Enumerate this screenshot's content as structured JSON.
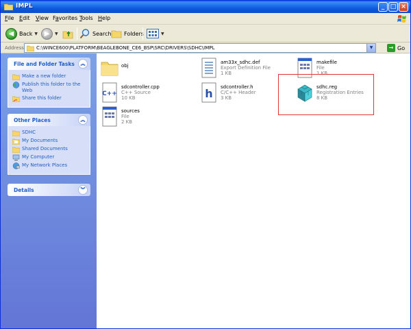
{
  "window": {
    "title": "IMPL"
  },
  "menu": [
    "File",
    "Edit",
    "View",
    "Favorites",
    "Tools",
    "Help"
  ],
  "menu_mnemonics": [
    "F",
    "E",
    "V",
    "a",
    "T",
    "H"
  ],
  "toolbar": {
    "back": "Back",
    "search": "Search",
    "folders": "Folders"
  },
  "address": {
    "label": "Address",
    "path": "C:\\WINCE600\\PLATFORM\\BEAGLEBONE_CE6_BSP\\SRC\\DRIVERS\\SDHC\\IMPL",
    "go": "Go"
  },
  "left": {
    "tasks": {
      "title": "File and Folder Tasks",
      "items": [
        "Make a new folder",
        "Publish this folder to the Web",
        "Share this folder"
      ]
    },
    "places": {
      "title": "Other Places",
      "items": [
        "SDHC",
        "My Documents",
        "Shared Documents",
        "My Computer",
        "My Network Places"
      ]
    },
    "details": {
      "title": "Details"
    }
  },
  "files": [
    {
      "name": "obj",
      "type": "",
      "size": "",
      "icon": "folder-icon"
    },
    {
      "name": "am33x_sdhc.def",
      "type": "Export Definition File",
      "size": "1 KB",
      "icon": "def-file-icon"
    },
    {
      "name": "makefile",
      "type": "File",
      "size": "1 KB",
      "icon": "generic-file-icon"
    },
    {
      "name": "sdcontroller.cpp",
      "type": "C++ Source",
      "size": "10 KB",
      "icon": "cpp-file-icon"
    },
    {
      "name": "sdcontroller.h",
      "type": "C/C++ Header",
      "size": "3 KB",
      "icon": "header-file-icon"
    },
    {
      "name": "sdhc.reg",
      "type": "Registration Entries",
      "size": "8 KB",
      "icon": "registry-file-icon"
    },
    {
      "name": "sources",
      "type": "File",
      "size": "2 KB",
      "icon": "generic-file-icon"
    }
  ],
  "colors": {
    "title_bar": "#0a5ee8",
    "task_link": "#215dc6",
    "highlight": "#e33333"
  }
}
